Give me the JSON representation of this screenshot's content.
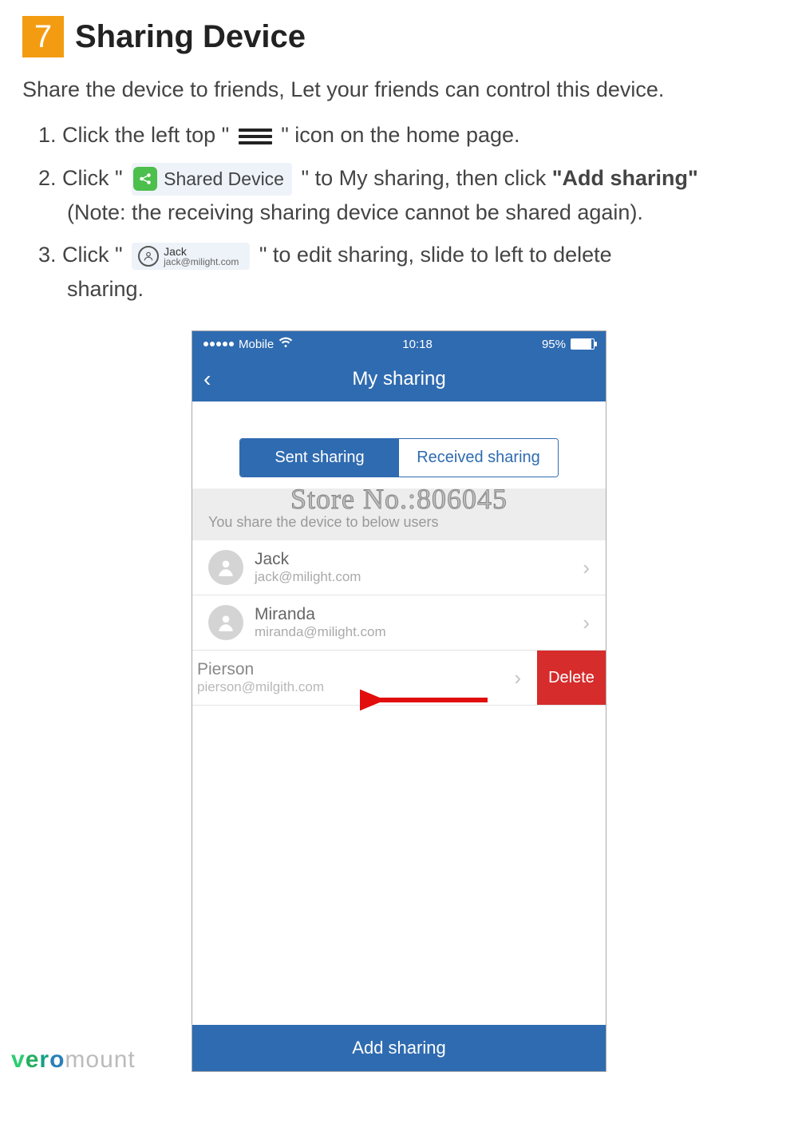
{
  "header": {
    "step_number": "7",
    "title": "Sharing Device"
  },
  "intro": "Share the device to friends, Let your friends can control this device.",
  "steps": {
    "s1_a": "1. Click the left top \" ",
    "s1_b": " \" icon on the home page.",
    "s2_a": "2. Click \" ",
    "s2_pill": "Shared Device",
    "s2_b": " \" to My sharing, then click",
    "s2_bold": "\"Add sharing\"",
    "s2_note": "(Note: the receiving sharing device cannot be shared again).",
    "s3_a": "3. Click \" ",
    "s3_chip_name": "Jack",
    "s3_chip_email": "jack@milight.com",
    "s3_b": " \" to edit sharing, slide to left to delete",
    "s3_c": "sharing."
  },
  "phone": {
    "status": {
      "carrier": "Mobile",
      "time": "10:18",
      "battery": "95%"
    },
    "nav_title": "My sharing",
    "tabs": {
      "sent": "Sent sharing",
      "received": "Received sharing"
    },
    "watermark": "Store No.:806045",
    "section_header": "You share the device to below users",
    "users": [
      {
        "name": "Jack",
        "email": "jack@milight.com"
      },
      {
        "name": "Miranda",
        "email": "miranda@milight.com"
      }
    ],
    "swiped": {
      "name": "Pierson",
      "email": "pierson@milgith.com",
      "delete_label": "Delete"
    },
    "add_button": "Add sharing"
  },
  "brand": {
    "p1": "v",
    "p2": "e",
    "p3": "r",
    "p4": "o",
    "p5": "mount"
  }
}
